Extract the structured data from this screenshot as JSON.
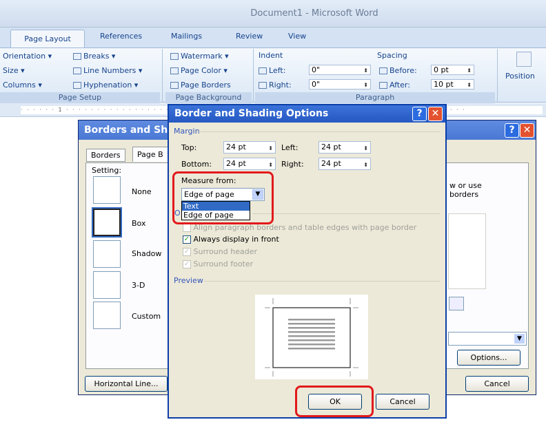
{
  "window": {
    "title": "Document1 - Microsoft Word"
  },
  "ribbon_tabs": [
    "Page Layout",
    "References",
    "Mailings",
    "Review",
    "View"
  ],
  "ribbon": {
    "orientation": "Orientation ▾",
    "size": "Size ▾",
    "columns": "Columns ▾",
    "breaks": "Breaks ▾",
    "line_numbers": "Line Numbers ▾",
    "hyphenation": "Hyphenation ▾",
    "page_setup_group": "Page Setup",
    "watermark": "Watermark ▾",
    "page_color": "Page Color ▾",
    "page_borders": "Page Borders",
    "page_background_group": "Page Background",
    "indent_label": "Indent",
    "indent_left_label": "Left:",
    "indent_left_value": "0\"",
    "indent_right_label": "Right:",
    "indent_right_value": "0\"",
    "spacing_label": "Spacing",
    "before_label": "Before:",
    "before_value": "0 pt",
    "after_label": "After:",
    "after_value": "10 pt",
    "paragraph_group": "Paragraph",
    "position": "Position"
  },
  "ruler": {
    "marks": "· · · · · · 1 · · · · · · · · · · · · · · · · · · · · · · · · · · · · · · · · · · · · · · · · · · · · · · · · · · · · · · · · · · · 5 · · · ·"
  },
  "borders_dialog": {
    "title": "Borders and Sha",
    "tab_borders": "Borders",
    "tab_page": "Page B",
    "setting_label": "Setting:",
    "settings": [
      "None",
      "Box",
      "Shadow",
      "3-D",
      "Custom"
    ],
    "hint_line1": "w or use",
    "hint_line2": "borders",
    "horizontal_line": "Horizontal Line...",
    "options": "Options...",
    "cancel": "Cancel"
  },
  "options_dialog": {
    "title": "Border and Shading Options",
    "margin_label": "Margin",
    "top_label": "Top:",
    "top_value": "24 pt",
    "left_label": "Left:",
    "left_value": "24 pt",
    "bottom_label": "Bottom:",
    "bottom_value": "24 pt",
    "right_label": "Right:",
    "right_value": "24 pt",
    "measure_from_label": "Measure from:",
    "measure_from_value": "Edge of page",
    "measure_options": [
      "Text",
      "Edge of page"
    ],
    "options_prefix": "O",
    "align_paragraph": "Align paragraph borders and table edges with page border",
    "always_front": "Always display in front",
    "surround_header": "Surround header",
    "surround_footer": "Surround footer",
    "preview_label": "Preview",
    "ok": "OK",
    "cancel": "Cancel"
  },
  "colors": {
    "highlight": "#e2191c",
    "title_bar": "#2658c2",
    "select": "#316ac5"
  }
}
